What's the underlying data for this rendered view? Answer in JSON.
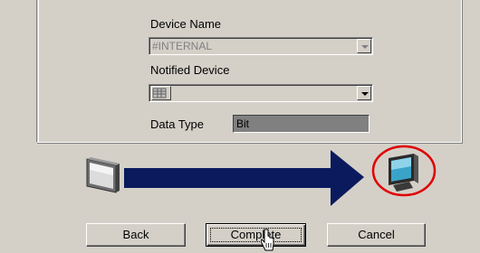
{
  "form": {
    "device_name_label": "Device Name",
    "device_name_value": "#INTERNAL",
    "notified_device_label": "Notified Device",
    "notified_device_value": "",
    "data_type_label": "Data Type",
    "data_type_value": "Bit"
  },
  "buttons": {
    "back": "Back",
    "complete": "Complete",
    "cancel": "Cancel"
  },
  "icons": {
    "source": "display-panel-icon",
    "target": "monitor-icon",
    "flow": "right-arrow"
  },
  "colors": {
    "arrow": "#0a1a5c",
    "highlight_circle": "#e00000",
    "window_bg": "#d4d0c8"
  }
}
